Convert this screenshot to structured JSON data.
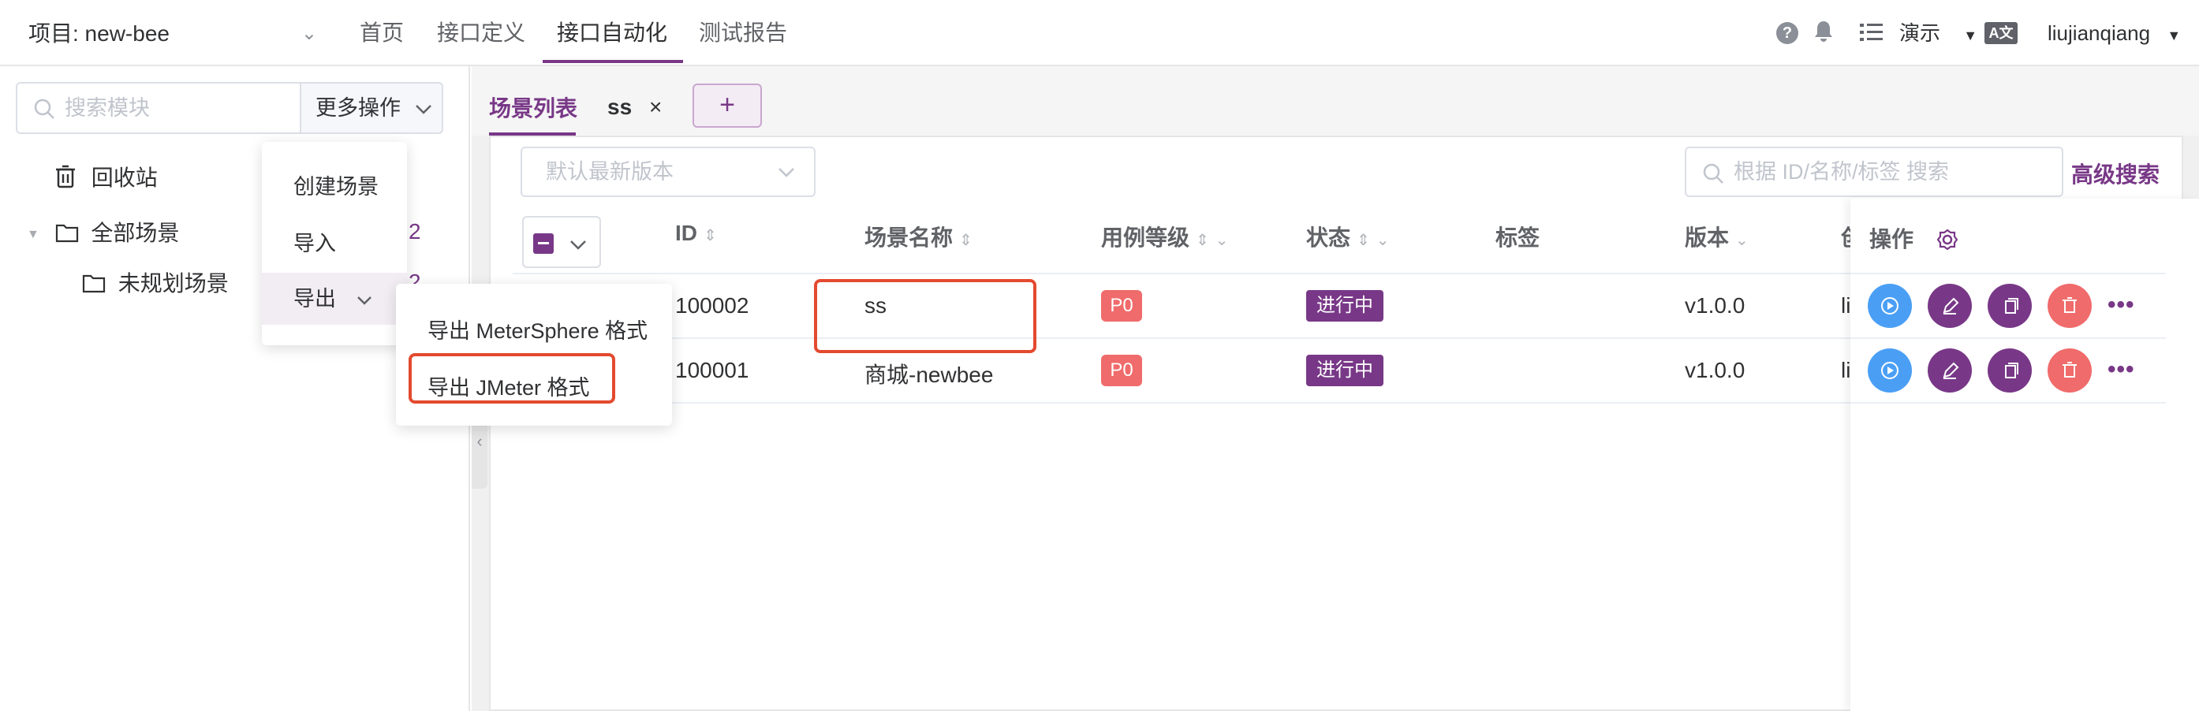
{
  "header": {
    "project_label": "项目: new-bee",
    "nav": [
      "首页",
      "接口定义",
      "接口自动化",
      "测试报告"
    ],
    "help_glyph": "?",
    "workspace": "演示",
    "lang_glyph": "A文",
    "username": "liujianqiang",
    "accent_color": "#783887"
  },
  "sidebar": {
    "search_placeholder": "搜索模块",
    "more_ops_label": "更多操作",
    "recycle_label": "回收站",
    "all_scenarios_label": "全部场景",
    "all_scenarios_count": "2",
    "unplanned_label": "未规划场景",
    "unplanned_count": "2"
  },
  "dropdown": {
    "create": "创建场景",
    "import": "导入",
    "export": "导出",
    "export_ms": "导出 MeterSphere 格式",
    "export_jmeter": "导出 JMeter 格式"
  },
  "tabs": {
    "list": "场景列表",
    "ss": "ss",
    "close_glyph": "×",
    "add_glyph": "+"
  },
  "toolbar": {
    "version_placeholder": "默认最新版本",
    "search_placeholder": "根据 ID/名称/标签 搜索",
    "advanced_search": "高级搜索"
  },
  "table": {
    "columns": {
      "id": "ID",
      "name": "场景名称",
      "level": "用例等级",
      "status": "状态",
      "tags": "标签",
      "version": "版本",
      "creator": "创",
      "ops": "操作"
    },
    "rows": [
      {
        "id": "100002",
        "name": "ss",
        "level": "P0",
        "status": "进行中",
        "version": "v1.0.0",
        "creator": "li"
      },
      {
        "id": "100001",
        "name": "商城-newbee",
        "level": "P0",
        "status": "进行中",
        "version": "v1.0.0",
        "creator": "li"
      }
    ],
    "more_glyph": "•••"
  },
  "colors": {
    "run": "#4a9ff5",
    "edit": "#783887",
    "copy": "#783887",
    "delete": "#f06b6b",
    "highlight_box": "#e34a2f"
  }
}
